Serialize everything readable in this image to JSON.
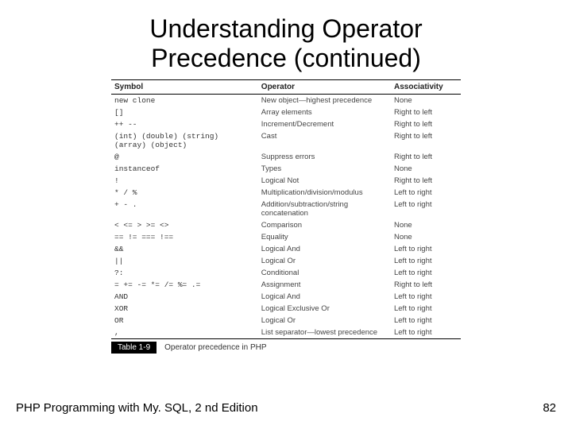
{
  "title_line1": "Understanding Operator",
  "title_line2": "Precedence (continued)",
  "headers": {
    "symbol": "Symbol",
    "operator": "Operator",
    "assoc": "Associativity"
  },
  "rows": [
    {
      "symbol": "new  clone",
      "operator": "New object—highest precedence",
      "assoc": "None"
    },
    {
      "symbol": "[]",
      "operator": "Array elements",
      "assoc": "Right to left"
    },
    {
      "symbol": "++ --",
      "operator": "Increment/Decrement",
      "assoc": "Right to left"
    },
    {
      "symbol": "(int) (double) (string)\n(array) (object)",
      "operator": "Cast",
      "assoc": "Right to left"
    },
    {
      "symbol": "@",
      "operator": "Suppress errors",
      "assoc": "Right to left"
    },
    {
      "symbol": "instanceof",
      "operator": "Types",
      "assoc": "None"
    },
    {
      "symbol": "!",
      "operator": "Logical Not",
      "assoc": "Right to left"
    },
    {
      "symbol": "* / %",
      "operator": "Multiplication/division/modulus",
      "assoc": "Left to right"
    },
    {
      "symbol": "+ - .",
      "operator": "Addition/subtraction/string concatenation",
      "assoc": "Left to right"
    },
    {
      "symbol": "< <= > >= <>",
      "operator": "Comparison",
      "assoc": "None"
    },
    {
      "symbol": "== != === !==",
      "operator": "Equality",
      "assoc": "None"
    },
    {
      "symbol": "&&",
      "operator": "Logical And",
      "assoc": "Left to right"
    },
    {
      "symbol": "||",
      "operator": "Logical Or",
      "assoc": "Left to right"
    },
    {
      "symbol": "?:",
      "operator": "Conditional",
      "assoc": "Left to right"
    },
    {
      "symbol": "= += -= *= /= %= .=",
      "operator": "Assignment",
      "assoc": "Right to left"
    },
    {
      "symbol": "AND",
      "operator": "Logical And",
      "assoc": "Left to right"
    },
    {
      "symbol": "XOR",
      "operator": "Logical Exclusive Or",
      "assoc": "Left to right"
    },
    {
      "symbol": "OR",
      "operator": "Logical Or",
      "assoc": "Left to right"
    },
    {
      "symbol": ",",
      "operator": "List separator—lowest precedence",
      "assoc": "Left to right"
    }
  ],
  "caption": {
    "tag": "Table 1-9",
    "text": "Operator precedence in PHP"
  },
  "footer": {
    "left": "PHP Programming with My. SQL, 2 nd Edition",
    "right": "82"
  }
}
